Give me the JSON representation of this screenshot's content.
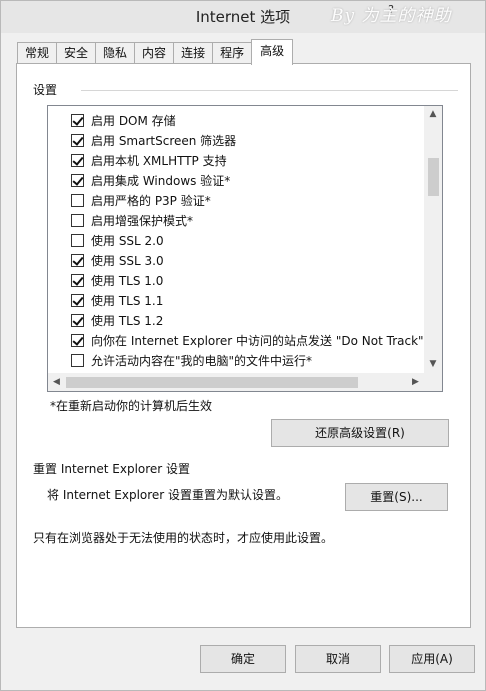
{
  "window": {
    "title": "Internet 选项",
    "help": "?"
  },
  "watermark": "By 为主的神助",
  "tabs": [
    {
      "label": "常规",
      "active": false
    },
    {
      "label": "安全",
      "active": false
    },
    {
      "label": "隐私",
      "active": false
    },
    {
      "label": "内容",
      "active": false
    },
    {
      "label": "连接",
      "active": false
    },
    {
      "label": "程序",
      "active": false
    },
    {
      "label": "高级",
      "active": true
    }
  ],
  "settings": {
    "group_label": "设置",
    "items": [
      {
        "label": "启用 DOM 存储",
        "checked": true
      },
      {
        "label": "启用 SmartScreen 筛选器",
        "checked": true
      },
      {
        "label": "启用本机 XMLHTTP 支持",
        "checked": true
      },
      {
        "label": "启用集成 Windows 验证*",
        "checked": true
      },
      {
        "label": "启用严格的 P3P 验证*",
        "checked": false
      },
      {
        "label": "启用增强保护模式*",
        "checked": false
      },
      {
        "label": "使用 SSL 2.0",
        "checked": false
      },
      {
        "label": "使用 SSL 3.0",
        "checked": true
      },
      {
        "label": "使用 TLS 1.0",
        "checked": true
      },
      {
        "label": "使用 TLS 1.1",
        "checked": true
      },
      {
        "label": "使用 TLS 1.2",
        "checked": true
      },
      {
        "label": "向你在 Internet Explorer 中访问的站点发送 \"Do Not Track\"",
        "checked": true
      },
      {
        "label": "允许活动内容在\"我的电脑\"的文件中运行*",
        "checked": false
      }
    ],
    "restart_note": "*在重新启动你的计算机后生效",
    "restore_button": "还原高级设置(R)"
  },
  "reset": {
    "header": "重置 Internet Explorer 设置",
    "description": "将 Internet Explorer 设置重置为默认设置。",
    "button": "重置(S)...",
    "note": "只有在浏览器处于无法使用的状态时，才应使用此设置。"
  },
  "footer": {
    "ok": "确定",
    "cancel": "取消",
    "apply": "应用(A)"
  }
}
